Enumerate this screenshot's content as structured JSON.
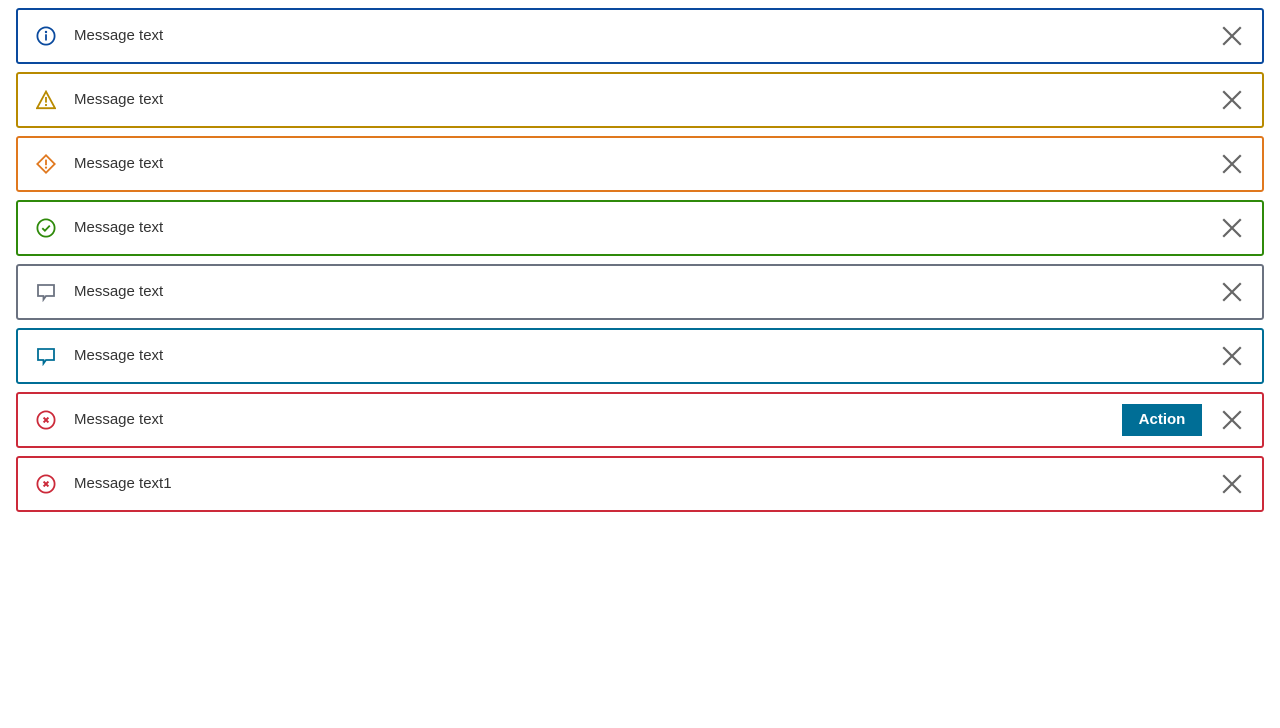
{
  "notifications": [
    {
      "kind": "info",
      "text": "Message text",
      "color": "#0a4a9e",
      "icon": "info-circle-icon"
    },
    {
      "kind": "warning",
      "text": "Message text",
      "color": "#b88a00",
      "icon": "warning-triangle-icon"
    },
    {
      "kind": "caution",
      "text": "Message text",
      "color": "#e0781e",
      "icon": "caution-diamond-icon"
    },
    {
      "kind": "success",
      "text": "Message text",
      "color": "#2f8a0a",
      "icon": "check-circle-icon"
    },
    {
      "kind": "neutral",
      "text": "Message text",
      "color": "#6b7280",
      "icon": "speech-bubble-icon"
    },
    {
      "kind": "discovery",
      "text": "Message text",
      "color": "#006e96",
      "icon": "speech-bubble-icon"
    },
    {
      "kind": "error",
      "text": "Message text",
      "color": "#cc2a3a",
      "icon": "error-circle-icon",
      "action_label": "Action"
    },
    {
      "kind": "error",
      "text": "Message text1",
      "color": "#cc2a3a",
      "icon": "error-circle-icon"
    }
  ],
  "close_icon_color": "#666666",
  "action_button_color": "#006e96"
}
